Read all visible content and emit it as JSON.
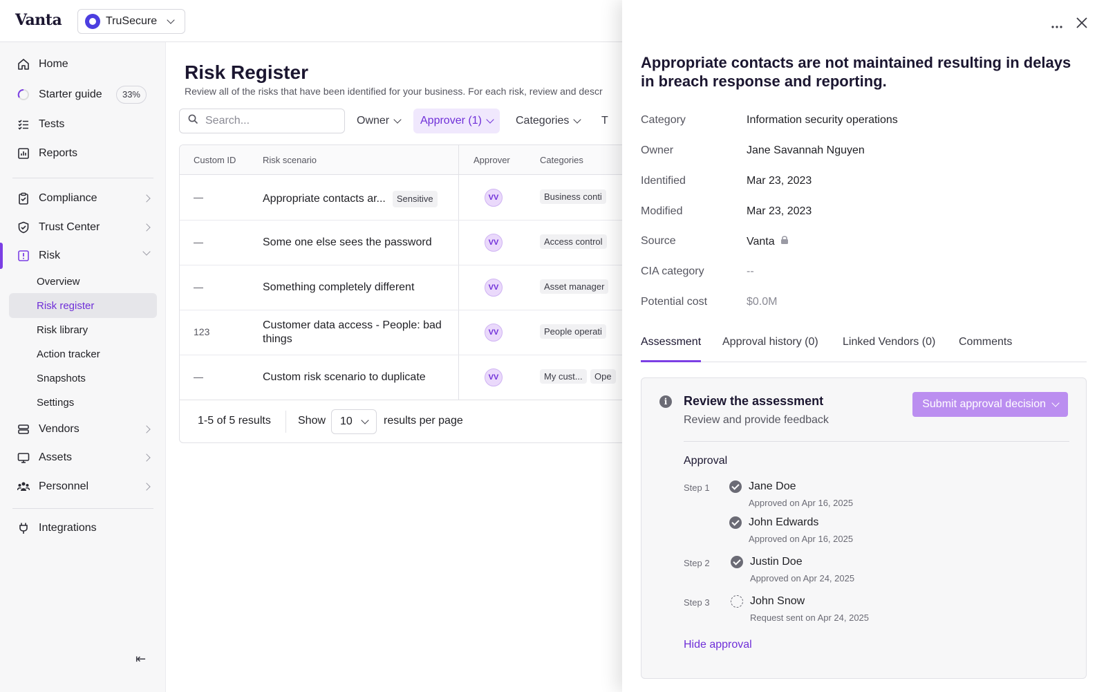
{
  "app": {
    "logo": "Vanta",
    "org": "TruSecure"
  },
  "sidebar": {
    "items": [
      {
        "label": "Home"
      },
      {
        "label": "Starter guide",
        "badge": "33%"
      },
      {
        "label": "Tests"
      },
      {
        "label": "Reports"
      },
      {
        "label": "Compliance"
      },
      {
        "label": "Trust Center"
      },
      {
        "label": "Risk"
      },
      {
        "label": "Vendors"
      },
      {
        "label": "Assets"
      },
      {
        "label": "Personnel"
      },
      {
        "label": "Integrations"
      }
    ],
    "risk_sub": [
      "Overview",
      "Risk register",
      "Risk library",
      "Action tracker",
      "Snapshots",
      "Settings"
    ],
    "collapse_icon": "⇤"
  },
  "main": {
    "title": "Risk Register",
    "subtitle": "Review all of the risks that have been identified for your business. For each risk, review and descr",
    "search_placeholder": "Search...",
    "filters": [
      "Owner",
      "Approver (1)",
      "Categories",
      "T"
    ],
    "columns": [
      "Custom ID",
      "Risk scenario",
      "Approver",
      "Categories"
    ],
    "rows": [
      {
        "id": "—",
        "scenario": "Appropriate contacts ar...",
        "tag": "Sensitive",
        "approver": "VV",
        "category": "Business conti"
      },
      {
        "id": "—",
        "scenario": "Some one else sees the password",
        "approver": "VV",
        "category": "Access control"
      },
      {
        "id": "—",
        "scenario": "Something completely different",
        "approver": "VV",
        "category": "Asset manager"
      },
      {
        "id": "123",
        "scenario": "Customer data access - People: bad things",
        "approver": "VV",
        "category": "People operati"
      },
      {
        "id": "—",
        "scenario": "Custom risk scenario to duplicate",
        "approver": "VV",
        "category": "My cust...",
        "category2": "Ope"
      }
    ],
    "footer": {
      "results": "1-5 of 5 results",
      "show": "Show",
      "per_page_value": "10",
      "per_page_label": "results per page"
    }
  },
  "drawer": {
    "title": "Appropriate contacts are not maintained resulting in delays in breach response and reporting.",
    "fields": [
      {
        "label": "Category",
        "value": "Information security operations"
      },
      {
        "label": "Owner",
        "value": "Jane Savannah Nguyen"
      },
      {
        "label": "Identified",
        "value": "Mar 23, 2023"
      },
      {
        "label": "Modified",
        "value": "Mar 23, 2023"
      },
      {
        "label": "Source",
        "value": "Vanta"
      },
      {
        "label": "CIA category",
        "value": "--"
      },
      {
        "label": "Potential cost",
        "value": "$0.0M"
      }
    ],
    "tabs": [
      "Assessment",
      "Approval history (0)",
      "Linked Vendors (0)",
      "Comments"
    ],
    "assessment": {
      "title": "Review the assessment",
      "subtitle": "Review and provide feedback",
      "submit": "Submit approval decision",
      "approval_title": "Approval",
      "steps": [
        {
          "step": "Step 1",
          "name": "Jane Doe",
          "meta": "Approved on Apr 16, 2025"
        },
        {
          "step": "",
          "name": "John Edwards",
          "meta": "Approved on Apr 16, 2025"
        },
        {
          "step": "Step 2",
          "name": "Justin Doe",
          "meta": "Approved on Apr 24, 2025"
        },
        {
          "step": "Step 3",
          "name": "John Snow",
          "meta": "Request sent on Apr 24, 2025"
        }
      ],
      "hide_link": "Hide approval"
    }
  }
}
